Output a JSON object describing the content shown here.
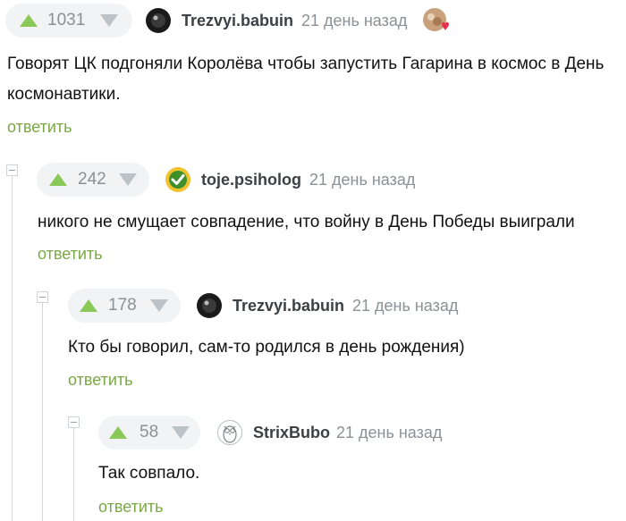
{
  "comments": [
    {
      "votes": "1031",
      "author": "Trezvyi.babuin",
      "time": "21 день назад",
      "text": "Говорят ЦК подгоняли Королёва чтобы запустить Гагарина в космос в День космонавтики.",
      "reply": "ответить"
    },
    {
      "votes": "242",
      "author": "toje.psiholog",
      "time": "21 день назад",
      "text": "никого не смущает совпадение, что войну в День Победы выиграли",
      "reply": "ответить"
    },
    {
      "votes": "178",
      "author": "Trezvyi.babuin",
      "time": "21 день назад",
      "text": "Кто бы говорил, сам-то родился в день рождения)",
      "reply": "ответить"
    },
    {
      "votes": "58",
      "author": "StrixBubo",
      "time": "21 день назад",
      "text": "Так совпало.",
      "reply": "ответить"
    }
  ],
  "colors": {
    "upvote": "#8ac858",
    "downvote": "#bcc3c8",
    "reply_link": "#7aa844",
    "vote_bg": "#f1f3f4"
  },
  "icons": {
    "header_badge": "heart-badge-icon"
  }
}
